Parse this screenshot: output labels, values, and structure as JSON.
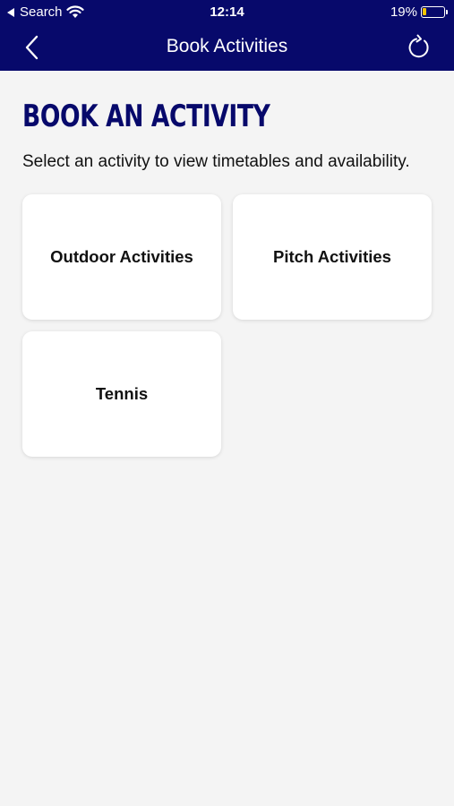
{
  "status_bar": {
    "back_app": "Search",
    "time": "12:14",
    "battery": "19%",
    "battery_level": 0.19
  },
  "nav": {
    "title": "Book Activities",
    "back_icon": "chevron-left-icon",
    "refresh_icon": "refresh-icon"
  },
  "main": {
    "heading": "BOOK AN ACTIVITY",
    "subtitle": "Select an activity to view timetables and availability.",
    "activities": [
      {
        "label": "Outdoor Activities"
      },
      {
        "label": "Pitch Activities"
      },
      {
        "label": "Tennis"
      }
    ]
  },
  "colors": {
    "brand": "#07096b",
    "background": "#f4f4f4",
    "card": "#ffffff"
  }
}
